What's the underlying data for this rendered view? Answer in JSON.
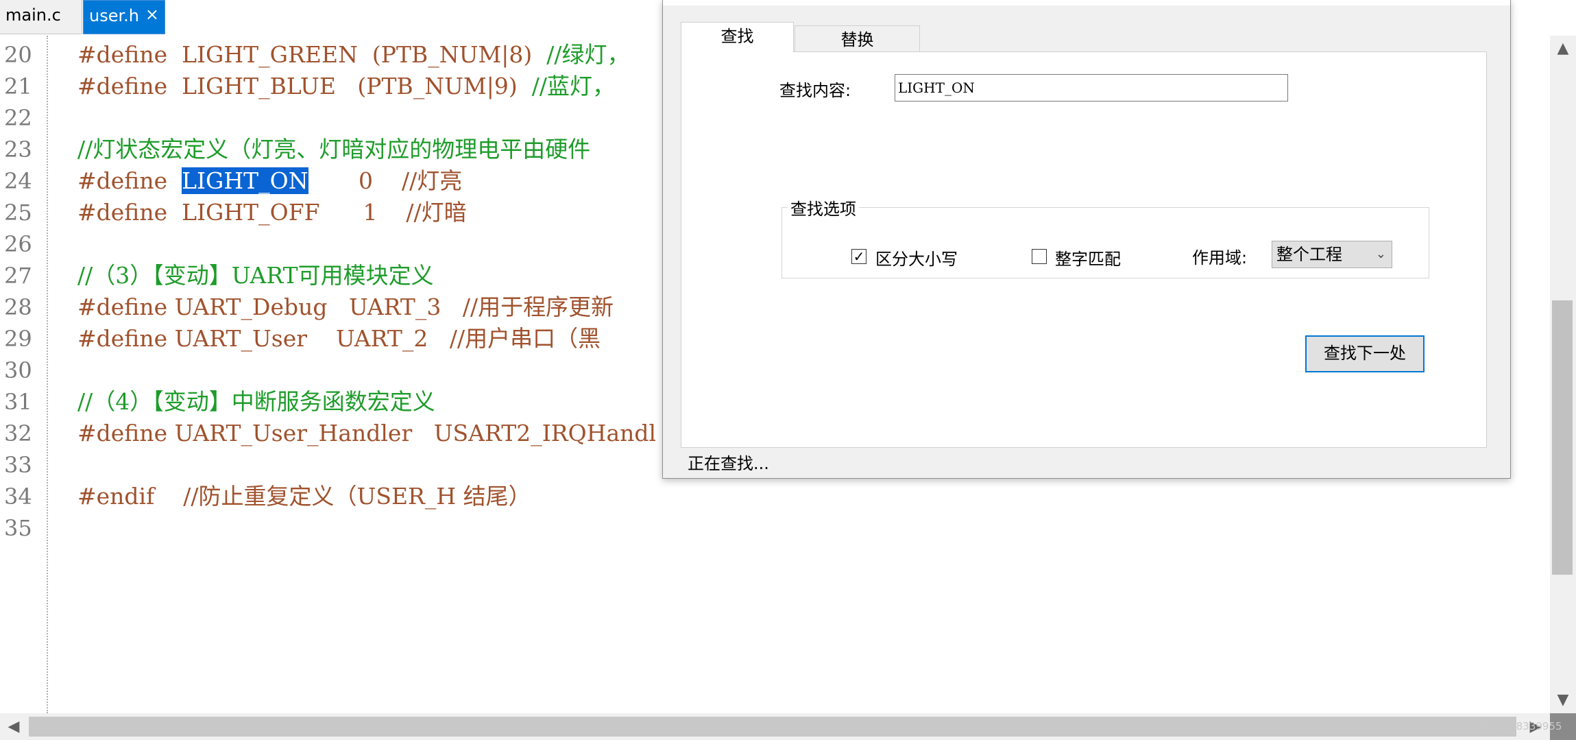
{
  "tabs": [
    {
      "label": "main.c"
    },
    {
      "label": "user.h",
      "close": "×"
    }
  ],
  "editor": {
    "lines": [
      {
        "num": "20",
        "parts": [
          {
            "t": "#define  LIGHT_GREEN  (PTB_NUM|8)  ",
            "c": "kw"
          },
          {
            "t": "//绿灯，",
            "c": "cm"
          }
        ]
      },
      {
        "num": "21",
        "parts": [
          {
            "t": "#define  LIGHT_BLUE   (PTB_NUM|9)  ",
            "c": "kw"
          },
          {
            "t": "//蓝灯，",
            "c": "cm"
          }
        ]
      },
      {
        "num": "22",
        "parts": []
      },
      {
        "num": "23",
        "parts": [
          {
            "t": "//灯状态宏定义（灯亮、灯暗对应的物理电平由硬件",
            "c": "cm"
          }
        ]
      },
      {
        "num": "24",
        "parts": [
          {
            "t": "#define  ",
            "c": "kw"
          },
          {
            "t": "LIGHT_ON",
            "c": "hl"
          },
          {
            "t": "       0    ",
            "c": "kw"
          },
          {
            "t": "//灯亮",
            "c": "kw"
          }
        ]
      },
      {
        "num": "25",
        "parts": [
          {
            "t": "#define  LIGHT_OFF      1    ",
            "c": "kw"
          },
          {
            "t": "//灯暗",
            "c": "kw"
          }
        ]
      },
      {
        "num": "26",
        "parts": []
      },
      {
        "num": "27",
        "parts": [
          {
            "t": "//（3）【变动】UART可用模块定义",
            "c": "cm"
          }
        ]
      },
      {
        "num": "28",
        "parts": [
          {
            "t": "#define UART_Debug   UART_3   ",
            "c": "kw"
          },
          {
            "t": "//用于程序更新",
            "c": "kw"
          }
        ]
      },
      {
        "num": "29",
        "parts": [
          {
            "t": "#define UART_User    UART_2   ",
            "c": "kw"
          },
          {
            "t": "//用户串口（黑",
            "c": "kw"
          }
        ]
      },
      {
        "num": "30",
        "parts": []
      },
      {
        "num": "31",
        "parts": [
          {
            "t": "//（4）【变动】中断服务函数宏定义",
            "c": "cm"
          }
        ]
      },
      {
        "num": "32",
        "parts": [
          {
            "t": "#define UART_User_Handler   USART2_IRQHandl",
            "c": "kw"
          }
        ]
      },
      {
        "num": "33",
        "parts": []
      },
      {
        "num": "34",
        "parts": [
          {
            "t": "#endif    ",
            "c": "kw"
          },
          {
            "t": "//防止重复定义（USER_H 结尾）",
            "c": "kw"
          }
        ]
      },
      {
        "num": "35",
        "parts": []
      }
    ]
  },
  "scroll": {
    "up": "▲",
    "down": "▼",
    "left": "◀",
    "right": "▶"
  },
  "dialog": {
    "tab_find": "查找",
    "tab_replace": "替换",
    "find_label": "查找内容:",
    "find_value": "LIGHT_ON",
    "options_title": "查找选项",
    "match_case_label": "区分大小写",
    "match_case_checked": true,
    "whole_word_label": "整字匹配",
    "whole_word_checked": false,
    "scope_label": "作用域:",
    "scope_value": "整个工程",
    "find_next": "查找下一处",
    "status": "正在查找..."
  },
  "watermark": "CSDN @m0_68339955",
  "colors": {
    "selection": "#0a64d4",
    "keyword": "#a0522d",
    "comment": "#1e9c2a",
    "active_tab": "#0078d7"
  }
}
